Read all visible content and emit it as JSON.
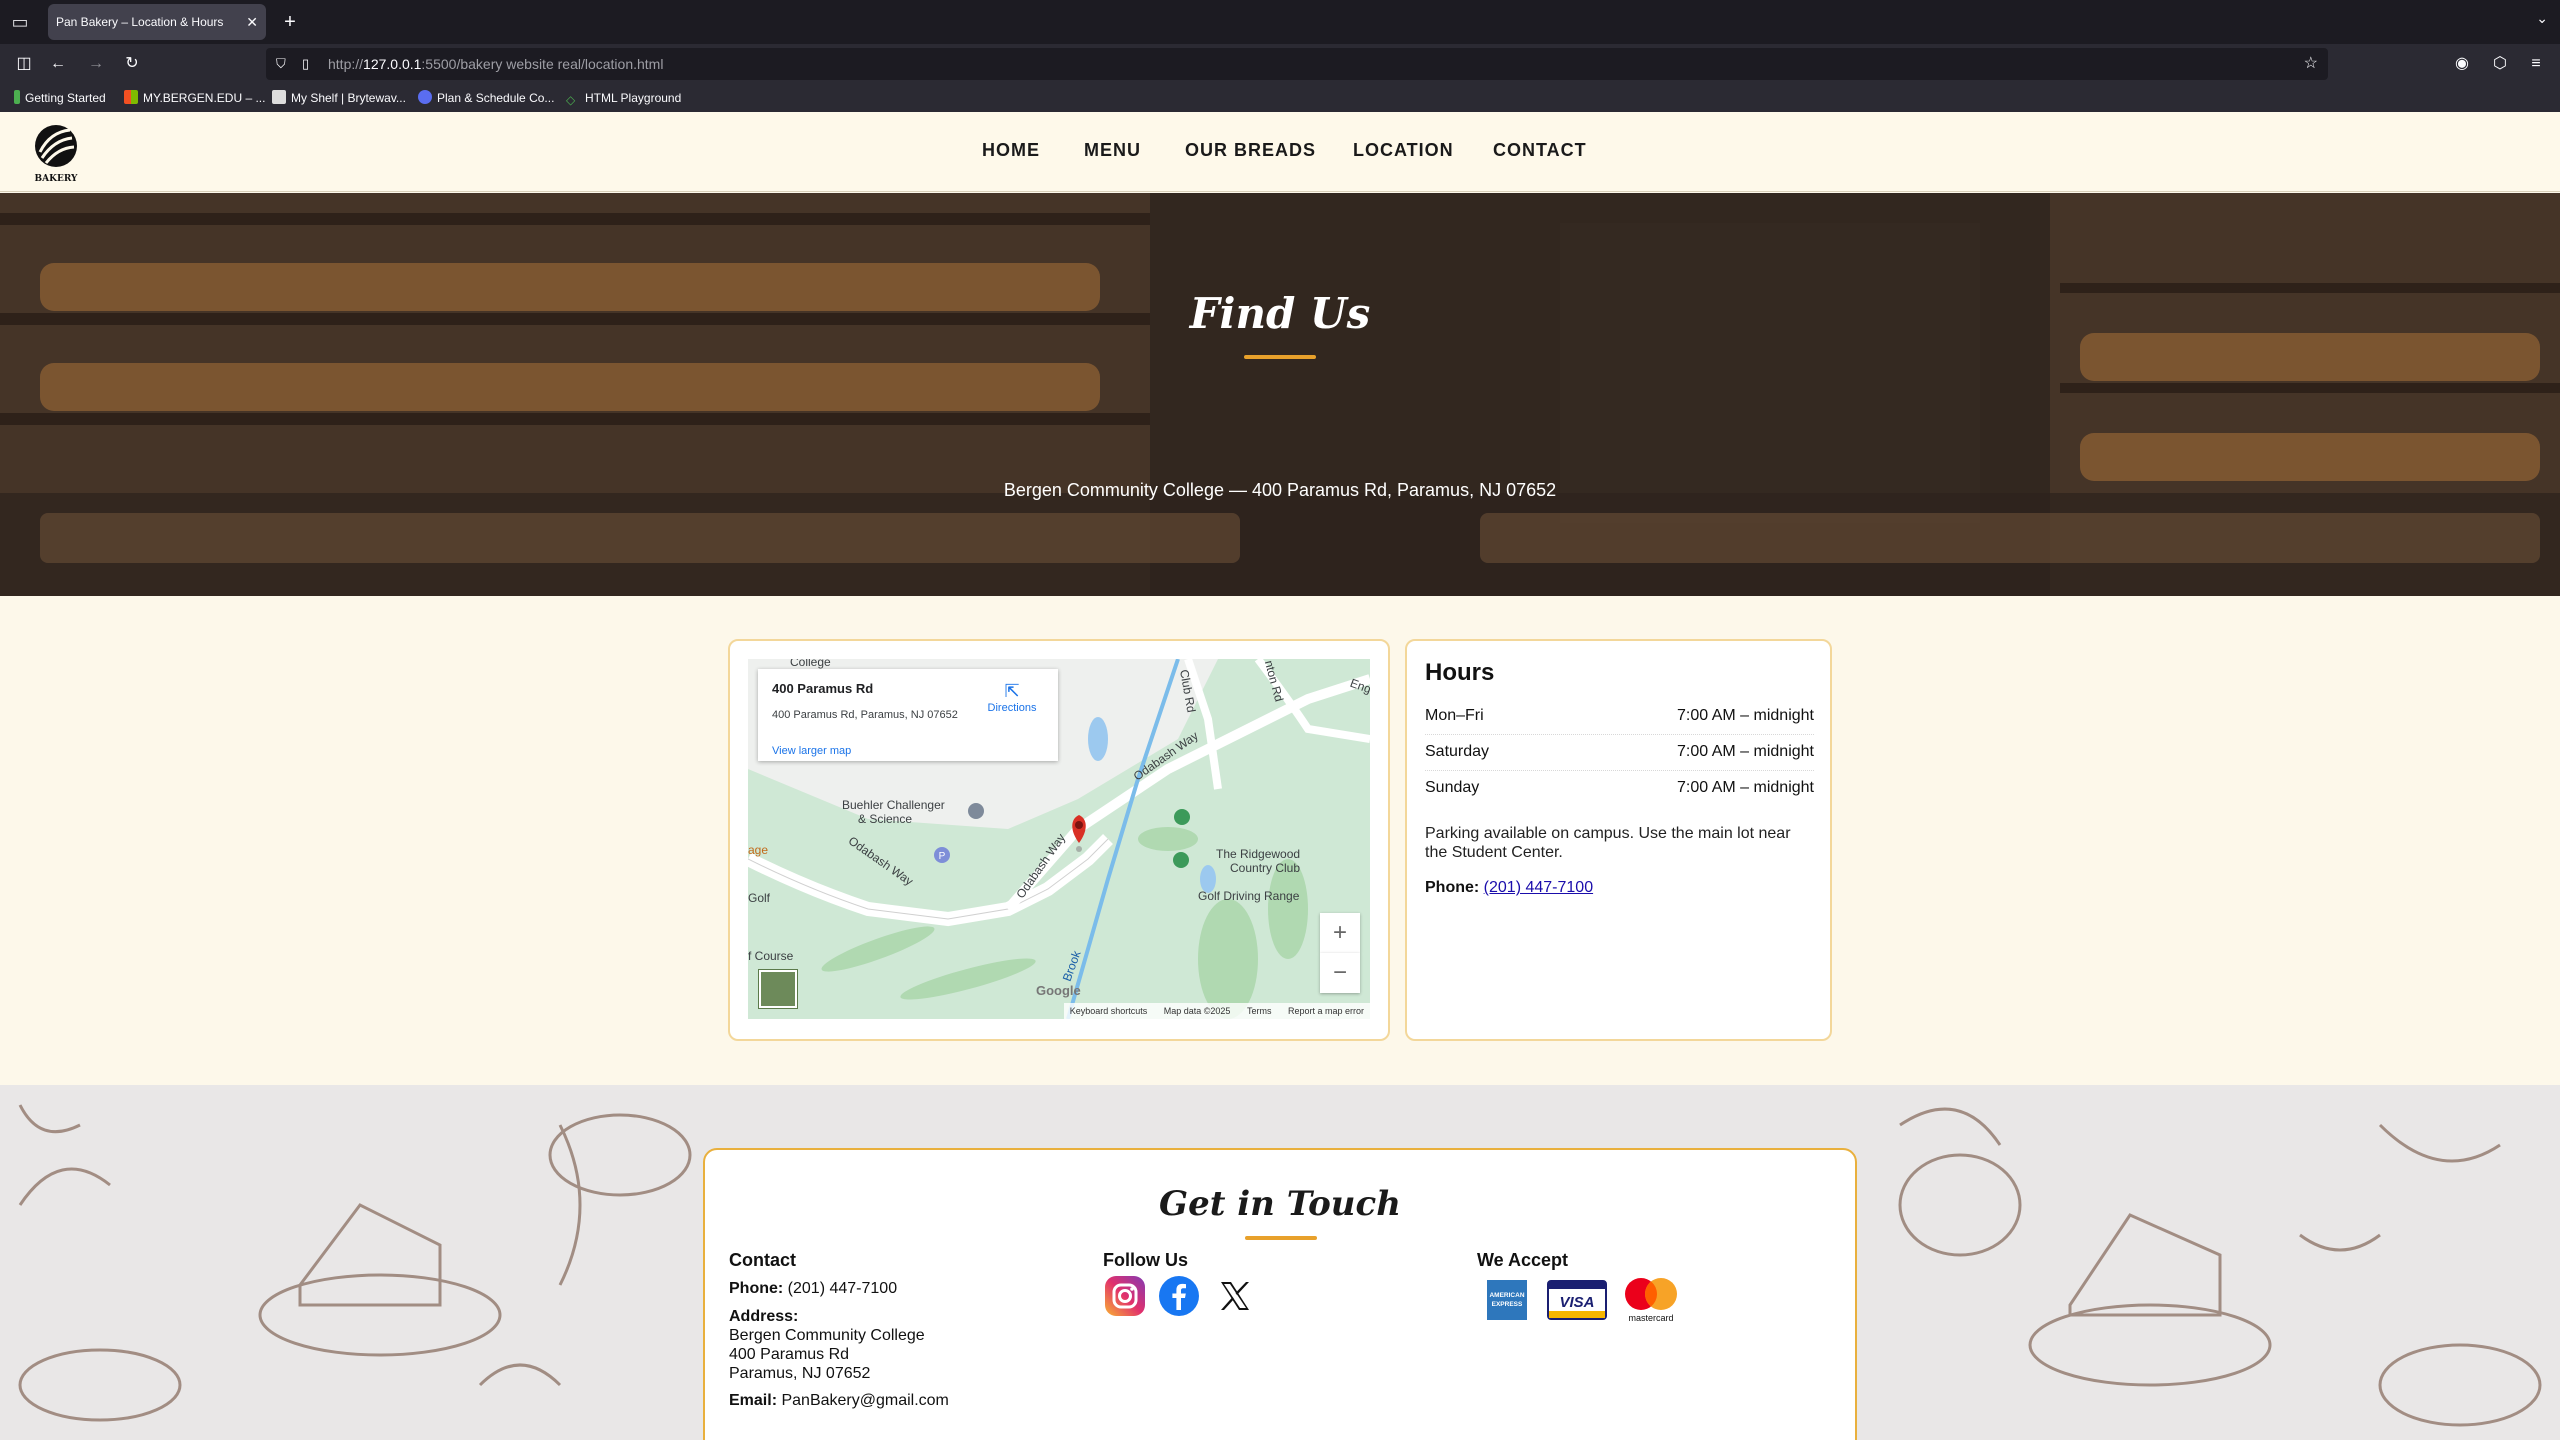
{
  "browser": {
    "tab_title": "Pan Bakery – Location & Hours",
    "url_prefix": "http://",
    "url_host": "127.0.0.1",
    "url_rest": ":5500/bakery website real/location.html",
    "bookmarks": [
      "Getting Started",
      "MY.BERGEN.EDU – ...",
      "My Shelf | Brytewav...",
      "Plan & Schedule Co...",
      "HTML Playground"
    ]
  },
  "header": {
    "logo_text": "BAKERY",
    "nav": [
      "HOME",
      "MENU",
      "OUR BREADS",
      "LOCATION",
      "CONTACT"
    ]
  },
  "hero": {
    "title": "Find Us",
    "subtitle": "Bergen Community College — 400 Paramus Rd, Paramus, NJ 07652"
  },
  "map": {
    "place_title": "400 Paramus Rd",
    "place_address": "400 Paramus Rd, Paramus, NJ 07652",
    "directions": "Directions",
    "view_larger": "View larger map",
    "labels": {
      "buehler": "Buehler Challenger",
      "buehler2": "& Science",
      "ridgewood": "The Ridgewood",
      "ridgewood2": "Country Club",
      "golf_driving": "Golf Driving Range",
      "odabash1": "Odabash Way",
      "odabash2": "Odabash Way",
      "odabash3": "Odabash Way",
      "club_rd": "Club Rd",
      "nton_rd": "nton Rd",
      "eng": "Eng",
      "golf": "Golf",
      "age": "age",
      "course": "f Course",
      "college": "College",
      "brook": "Brook",
      "google": "Google"
    },
    "footer": [
      "Keyboard shortcuts",
      "Map data ©2025",
      "Terms",
      "Report a map error"
    ]
  },
  "hours": {
    "title": "Hours",
    "rows": [
      {
        "day": "Mon–Fri",
        "time": "7:00 AM – midnight"
      },
      {
        "day": "Saturday",
        "time": "7:00 AM – midnight"
      },
      {
        "day": "Sunday",
        "time": "7:00 AM – midnight"
      }
    ],
    "parking": "Parking available on campus. Use the main lot near the Student Center.",
    "phone_label": "Phone:",
    "phone": "(201) 447-7100"
  },
  "contact": {
    "title": "Get in Touch",
    "contact_heading": "Contact",
    "phone_label": "Phone:",
    "phone": "(201) 447-7100",
    "address_label": "Address:",
    "address_lines": [
      "Bergen Community College",
      "400 Paramus Rd",
      "Paramus, NJ 07652"
    ],
    "email_label": "Email:",
    "email": "PanBakery@gmail.com",
    "follow_heading": "Follow Us",
    "accept_heading": "We Accept",
    "card_brands": [
      "AMERICAN EXPRESS",
      "VISA",
      "mastercard"
    ]
  },
  "colors": {
    "accent": "#e8a12b",
    "card_border": "#f3d79a",
    "page_bg": "#fdf8ea"
  }
}
